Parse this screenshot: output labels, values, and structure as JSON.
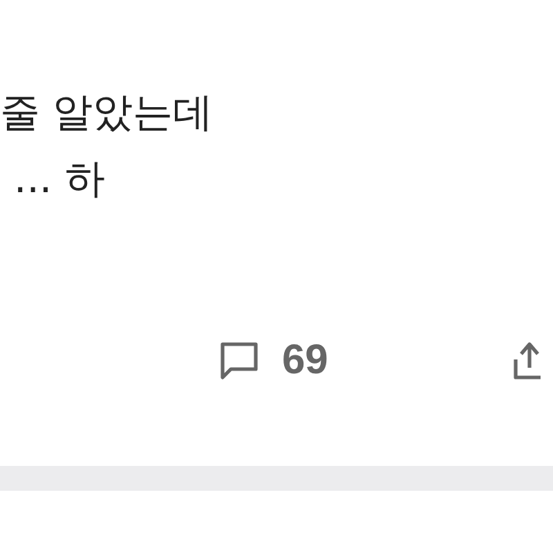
{
  "post": {
    "body_lines": [
      "줄 알았는데",
      "... 하"
    ]
  },
  "actions": {
    "comment_count": "69"
  }
}
